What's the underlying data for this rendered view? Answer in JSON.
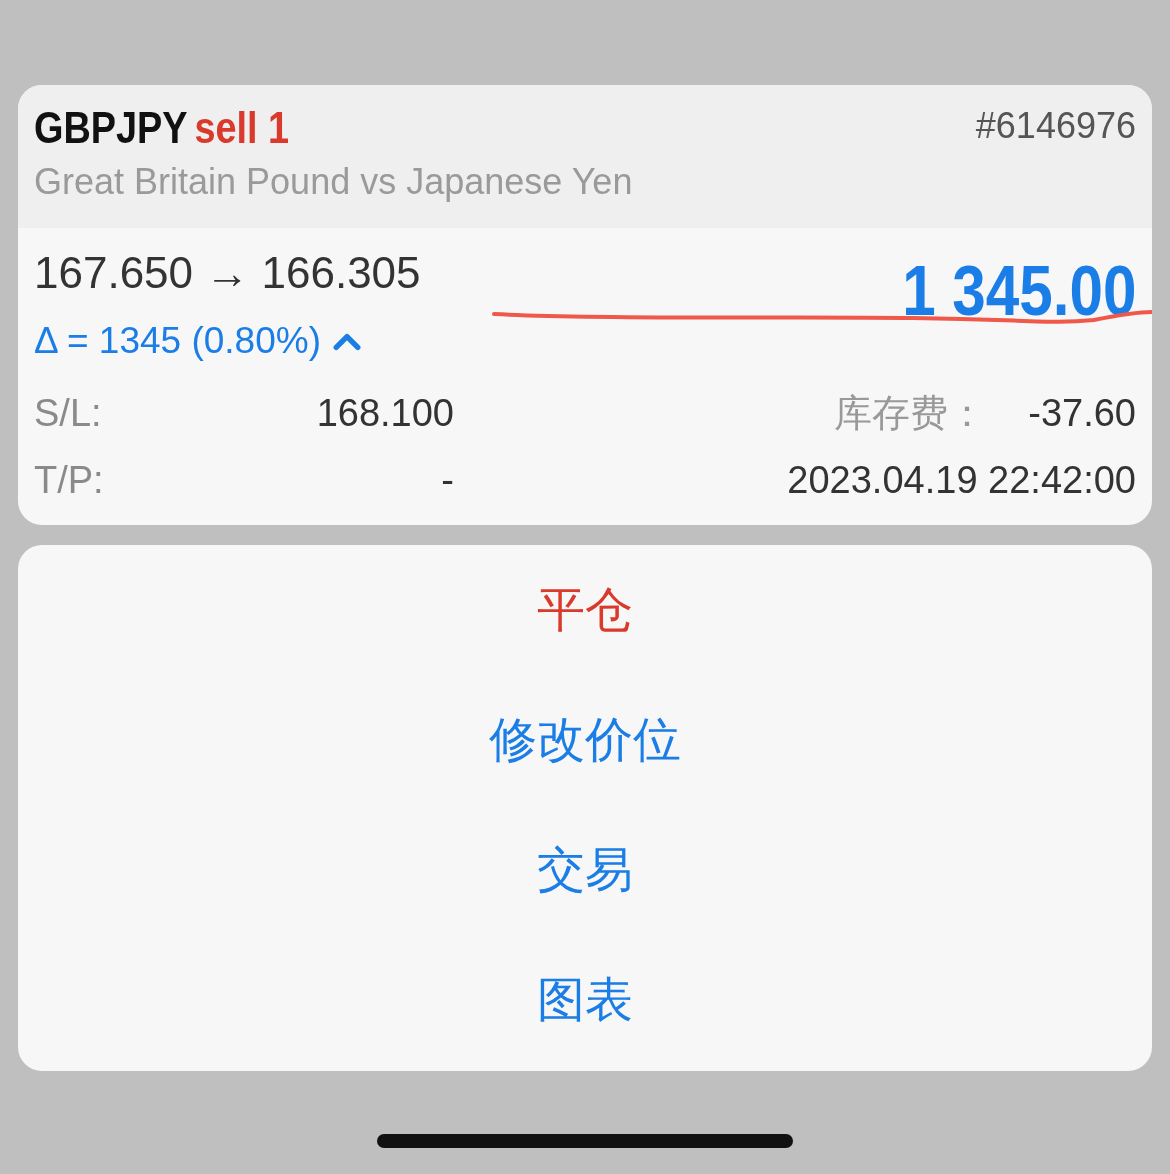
{
  "position": {
    "symbol": "GBPJPY",
    "side": "sell 1",
    "ticket": "#6146976",
    "description": "Great Britain Pound vs Japanese Yen",
    "prices": "167.650 → 166.305",
    "profit": "1 345.00",
    "delta": "Δ = 1345 (0.80%)",
    "fields": [
      {
        "label": "S/L:",
        "value": "168.100"
      },
      {
        "label": "T/P:",
        "value": "-"
      }
    ],
    "swap": {
      "label": "库存费：",
      "value": "-37.60"
    },
    "time": "2023.04.19 22:42:00"
  },
  "actions": [
    {
      "label": "平仓",
      "kind": "destructive"
    },
    {
      "label": "修改价位",
      "kind": "default"
    },
    {
      "label": "交易",
      "kind": "default"
    },
    {
      "label": "图表",
      "kind": "default"
    }
  ]
}
